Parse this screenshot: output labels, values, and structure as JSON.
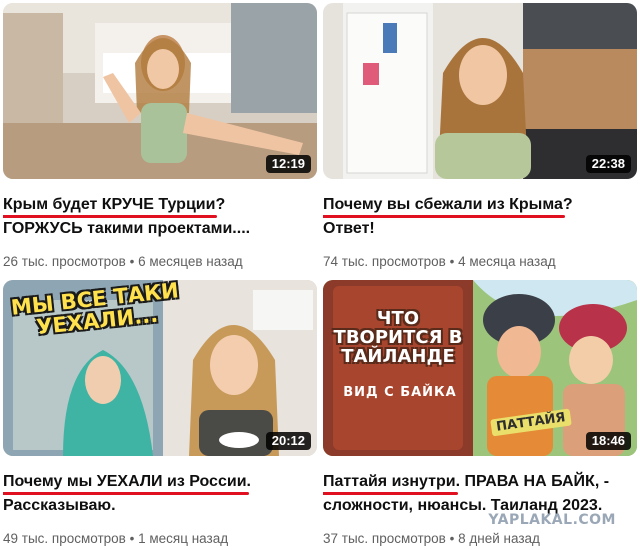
{
  "videos": [
    {
      "title_highlight": "Крым будет КРУЧЕ Турции",
      "title_rest": "?",
      "title_line2": "ГОРЖУСЬ такими проектами....",
      "views": "26 тыс. просмотров",
      "age": "6 месяцев назад",
      "duration": "12:19"
    },
    {
      "title_highlight": "Почему вы сбежали из Крыма",
      "title_rest": "?",
      "title_line2": "Ответ!",
      "views": "74 тыс. просмотров",
      "age": "4 месяца назад",
      "duration": "22:38"
    },
    {
      "title_highlight": "Почему мы УЕХАЛИ из России",
      "title_rest": ".",
      "title_line2": "Рассказываю.",
      "views": "49 тыс. просмотров",
      "age": "1 месяц назад",
      "duration": "20:12",
      "thumb_text": "МЫ ВСЕ ТАКИ УЕХАЛИ..."
    },
    {
      "title_highlight": "Паттайя изнутри",
      "title_rest": ". ПРАВА НА БАЙК, -",
      "title_line2": "сложности, нюансы. Таиланд 2023.",
      "views": "37 тыс. просмотров",
      "age": "8 дней назад",
      "duration": "18:46",
      "thumb_text": "ЧТО ТВОРИТСЯ В ТАЙЛАНДЕ",
      "thumb_sub": "ВИД С БАЙКА",
      "thumb_tag": "ПАТТАЙЯ"
    }
  ],
  "separator": "•",
  "watermark": "YAPLAKAL.COM",
  "colors": {
    "underline": "#e01020",
    "meta": "#606060",
    "title": "#0f0f0f"
  }
}
